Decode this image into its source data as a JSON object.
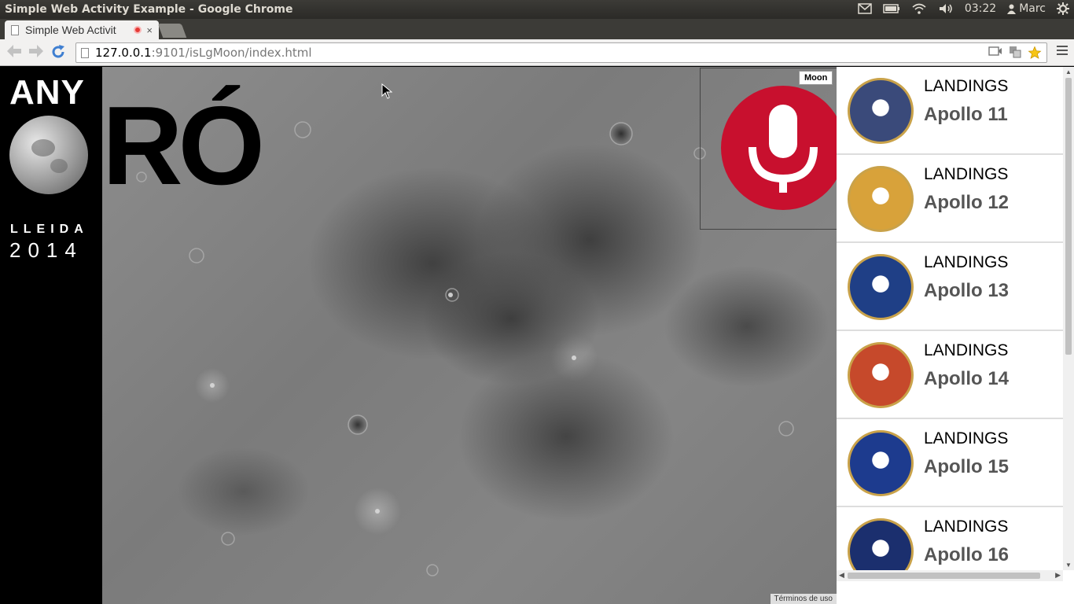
{
  "os": {
    "window_title": "Simple Web Activity Example - Google Chrome",
    "time": "03:22",
    "user": "Marc"
  },
  "browser": {
    "tab_title": "Simple Web Activit",
    "tab_close": "×",
    "url_host": "127.0.0.1",
    "url_rest": ":9101/isLgMoon/index.html"
  },
  "brand": {
    "line1": "ANY",
    "line2": "RÓ",
    "city": "LLEIDA",
    "year": "2014"
  },
  "map": {
    "type_label": "Moon",
    "terms": "Términos de uso"
  },
  "colors": {
    "mic_red": "#c8102e",
    "sidebar_bg": "#000000"
  },
  "landings": [
    {
      "kind": "LANDINGS",
      "mission": "Apollo 11",
      "patch_color": "#3a4a7a",
      "icon": "apollo-11-patch-icon"
    },
    {
      "kind": "LANDINGS",
      "mission": "Apollo 12",
      "patch_color": "#d8a23a",
      "icon": "apollo-12-patch-icon"
    },
    {
      "kind": "LANDINGS",
      "mission": "Apollo 13",
      "patch_color": "#1f3f86",
      "icon": "apollo-13-patch-icon"
    },
    {
      "kind": "LANDINGS",
      "mission": "Apollo 14",
      "patch_color": "#c6492b",
      "icon": "apollo-14-patch-icon"
    },
    {
      "kind": "LANDINGS",
      "mission": "Apollo 15",
      "patch_color": "#1d3b8e",
      "icon": "apollo-15-patch-icon"
    },
    {
      "kind": "LANDINGS",
      "mission": "Apollo 16",
      "patch_color": "#1b2f6e",
      "icon": "apollo-16-patch-icon"
    }
  ]
}
